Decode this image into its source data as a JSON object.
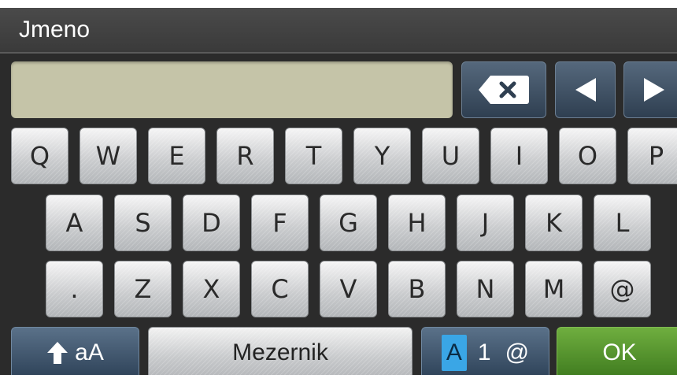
{
  "title": "Jmeno",
  "input": {
    "value": ""
  },
  "controls": {
    "backspace_icon": "backspace-icon",
    "left_icon": "arrow-left-icon",
    "right_icon": "arrow-right-icon"
  },
  "rows": {
    "row1": [
      "Q",
      "W",
      "E",
      "R",
      "T",
      "Y",
      "U",
      "I",
      "O",
      "P"
    ],
    "row2": [
      "A",
      "S",
      "D",
      "F",
      "G",
      "H",
      "J",
      "K",
      "L"
    ],
    "row3": [
      ".",
      "Z",
      "X",
      "C",
      "V",
      "B",
      "N",
      "M",
      "@"
    ]
  },
  "bottom": {
    "shift_label": "aA",
    "space_label": "Mezernik",
    "mode": {
      "a": "A",
      "num": "1",
      "sym": "@"
    },
    "ok_label": "OK"
  },
  "colors": {
    "input_bg": "#c5c4a8",
    "accent_blue": "#3aa6e6",
    "ok_green": "#5a9a30",
    "dark_key": "#3f5369"
  }
}
